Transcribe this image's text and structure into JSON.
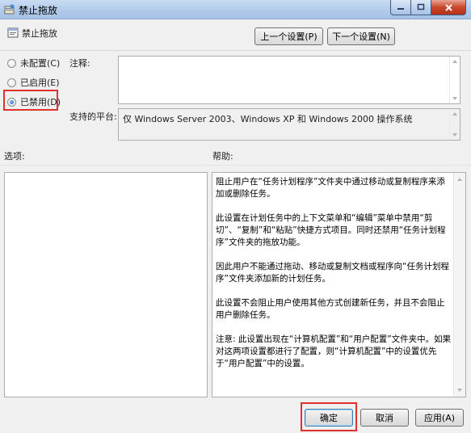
{
  "window": {
    "title": "禁止拖放"
  },
  "header": {
    "setting_name": "禁止拖放",
    "prev_label": "上一个设置(P)",
    "next_label": "下一个设置(N)"
  },
  "state": {
    "options": [
      {
        "label": "未配置(C)",
        "checked": false
      },
      {
        "label": "已启用(E)",
        "checked": false
      },
      {
        "label": "已禁用(D)",
        "checked": true
      }
    ]
  },
  "comment": {
    "label": "注释:",
    "value": ""
  },
  "platform": {
    "label": "支持的平台:",
    "value": "仅 Windows Server 2003、Windows XP 和 Windows 2000 操作系统"
  },
  "options_section": {
    "label": "选项:"
  },
  "help": {
    "label": "帮助:",
    "paragraphs": [
      "阻止用户在“任务计划程序”文件夹中通过移动或复制程序来添加或删除任务。",
      "此设置在计划任务中的上下文菜单和“编辑”菜单中禁用“剪切”、“复制”和“粘贴”快捷方式项目。同时还禁用“任务计划程序”文件夹的拖放功能。",
      "因此用户不能通过拖动、移动或复制文档或程序向“任务计划程序”文件夹添加新的计划任务。",
      "此设置不会阻止用户使用其他方式创建新任务，并且不会阻止用户删除任务。",
      "注意: 此设置出现在“计算机配置”和“用户配置”文件夹中。如果对这两项设置都进行了配置，则“计算机配置”中的设置优先于“用户配置”中的设置。"
    ]
  },
  "footer": {
    "ok_label": "确定",
    "cancel_label": "取消",
    "apply_label": "应用(A)"
  },
  "colors": {
    "highlight": "#e03030",
    "accent": "#3c7fb1"
  }
}
